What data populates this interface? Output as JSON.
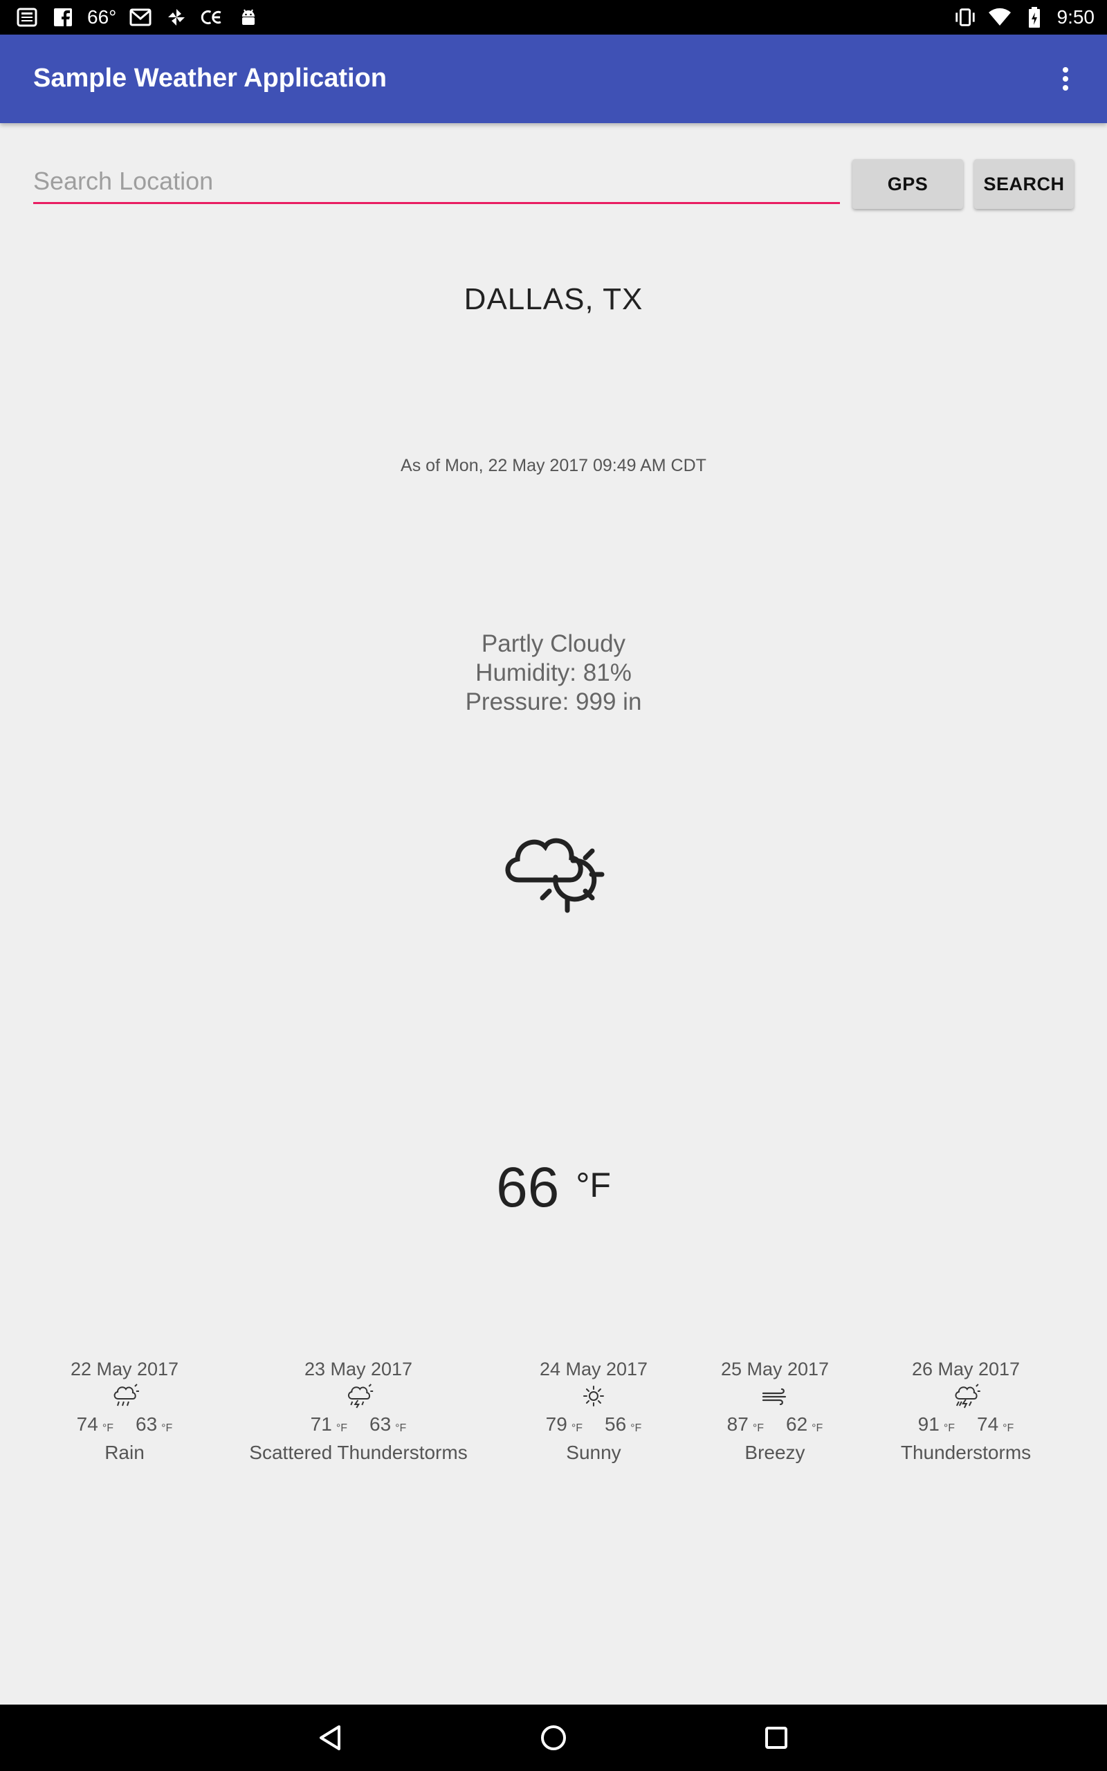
{
  "status_bar": {
    "temperature": "66°",
    "time": "9:50",
    "left_icons": [
      "news-icon",
      "facebook-icon",
      "gmail-icon",
      "pinwheel-icon",
      "ce-icon",
      "android-icon"
    ],
    "right_icons": [
      "vibrate-icon",
      "wifi-icon",
      "battery-icon"
    ]
  },
  "app_bar": {
    "title": "Sample Weather Application",
    "menu_icon": "more-vert-icon"
  },
  "search": {
    "placeholder": "Search Location",
    "value": "",
    "gps_label": "GPS",
    "search_label": "SEARCH",
    "underline_color": "#e91e63"
  },
  "current": {
    "city": "DALLAS,  TX",
    "as_of": "As of Mon, 22 May 2017 09:49 AM CDT",
    "condition": "Partly Cloudy",
    "humidity": "Humidity: 81%",
    "pressure": "Pressure: 999 in",
    "icon": "partly-cloudy-icon",
    "temperature": "66",
    "unit": "°F"
  },
  "forecast": [
    {
      "date": "22 May 2017",
      "icon": "rain-icon",
      "high": "74",
      "low": "63",
      "unit": "°F",
      "label": "Rain"
    },
    {
      "date": "23 May 2017",
      "icon": "scattered-thunderstorms-icon",
      "high": "71",
      "low": "63",
      "unit": "°F",
      "label": "Scattered Thunderstorms"
    },
    {
      "date": "24 May 2017",
      "icon": "sunny-icon",
      "high": "79",
      "low": "56",
      "unit": "°F",
      "label": "Sunny"
    },
    {
      "date": "25 May 2017",
      "icon": "breezy-icon",
      "high": "87",
      "low": "62",
      "unit": "°F",
      "label": "Breezy"
    },
    {
      "date": "26 May 2017",
      "icon": "thunderstorms-icon",
      "high": "91",
      "low": "74",
      "unit": "°F",
      "label": "Thunderstorms"
    }
  ],
  "nav_bar": {
    "buttons": [
      "back-icon",
      "home-icon",
      "recents-icon"
    ]
  },
  "colors": {
    "app_bar": "#3f51b5",
    "background": "#efefef",
    "accent": "#e91e63"
  }
}
